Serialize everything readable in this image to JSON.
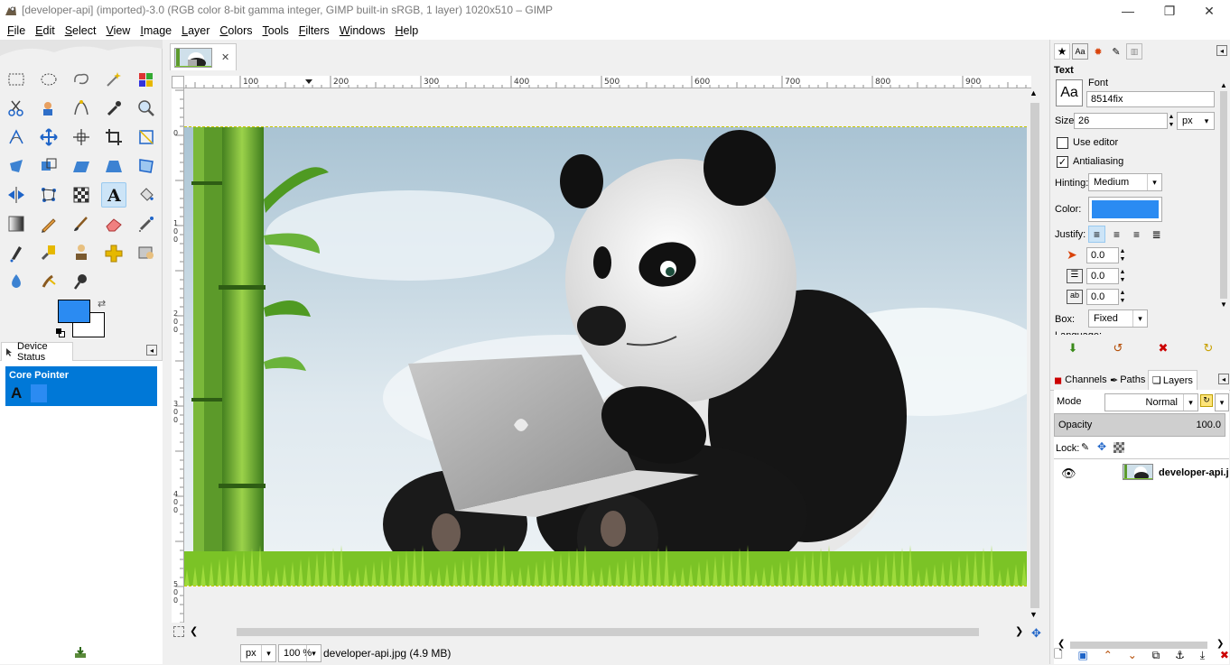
{
  "window": {
    "title": "[developer-api] (imported)-3.0 (RGB color 8-bit gamma integer, GIMP built-in sRGB, 1 layer) 1020x510 – GIMP",
    "minimize_glyph": "—",
    "restore_glyph": "❐",
    "close_glyph": "✕"
  },
  "menu": [
    "File",
    "Edit",
    "Select",
    "View",
    "Image",
    "Layer",
    "Colors",
    "Tools",
    "Filters",
    "Windows",
    "Help"
  ],
  "toolbox": {
    "active_tool": "text-tool",
    "foreground_color": "#2b8bf2",
    "background_color": "#ffffff",
    "device_status_tab": "Device Status",
    "core_pointer_label": "Core Pointer",
    "core_pointer_tool_glyph": "A"
  },
  "canvas": {
    "ruler_h_labels": [
      "100",
      "200",
      "300",
      "400",
      "500",
      "600",
      "700",
      "800",
      "900"
    ],
    "ruler_v_labels": [
      "0",
      "1\n0\n0",
      "2\n0\n0",
      "3\n0\n0",
      "4\n0\n0",
      "5\n0\n0"
    ],
    "image_tab_close": "✕"
  },
  "statusbar": {
    "unit": "px",
    "zoom": "100 %",
    "file_info": "developer-api.jpg (4.9 MB)"
  },
  "tool_options": {
    "section_title": "Text",
    "font_label": "Font",
    "font_preview": "Aa",
    "font_value": "8514fix",
    "size_label": "Size:",
    "size_value": "26",
    "size_unit": "px",
    "use_editor_label": "Use editor",
    "use_editor_checked": false,
    "antialiasing_label": "Antialiasing",
    "antialiasing_checked": true,
    "hinting_label": "Hinting:",
    "hinting_value": "Medium",
    "color_label": "Color:",
    "color_value": "#2b8bf2",
    "justify_label": "Justify:",
    "indent_value": "0.0",
    "line_spacing_value": "0.0",
    "letter_spacing_value": "0.0",
    "box_label": "Box:",
    "box_value": "Fixed",
    "language_label": "Language:"
  },
  "layers_dock": {
    "tabs": [
      "Channels",
      "Paths",
      "Layers"
    ],
    "active_tab": "Layers",
    "mode_label": "Mode",
    "mode_value": "Normal",
    "opacity_label": "Opacity",
    "opacity_value": "100.0",
    "lock_label": "Lock:",
    "layers": [
      {
        "name": "developer-api.jpg",
        "visible": true
      }
    ]
  }
}
